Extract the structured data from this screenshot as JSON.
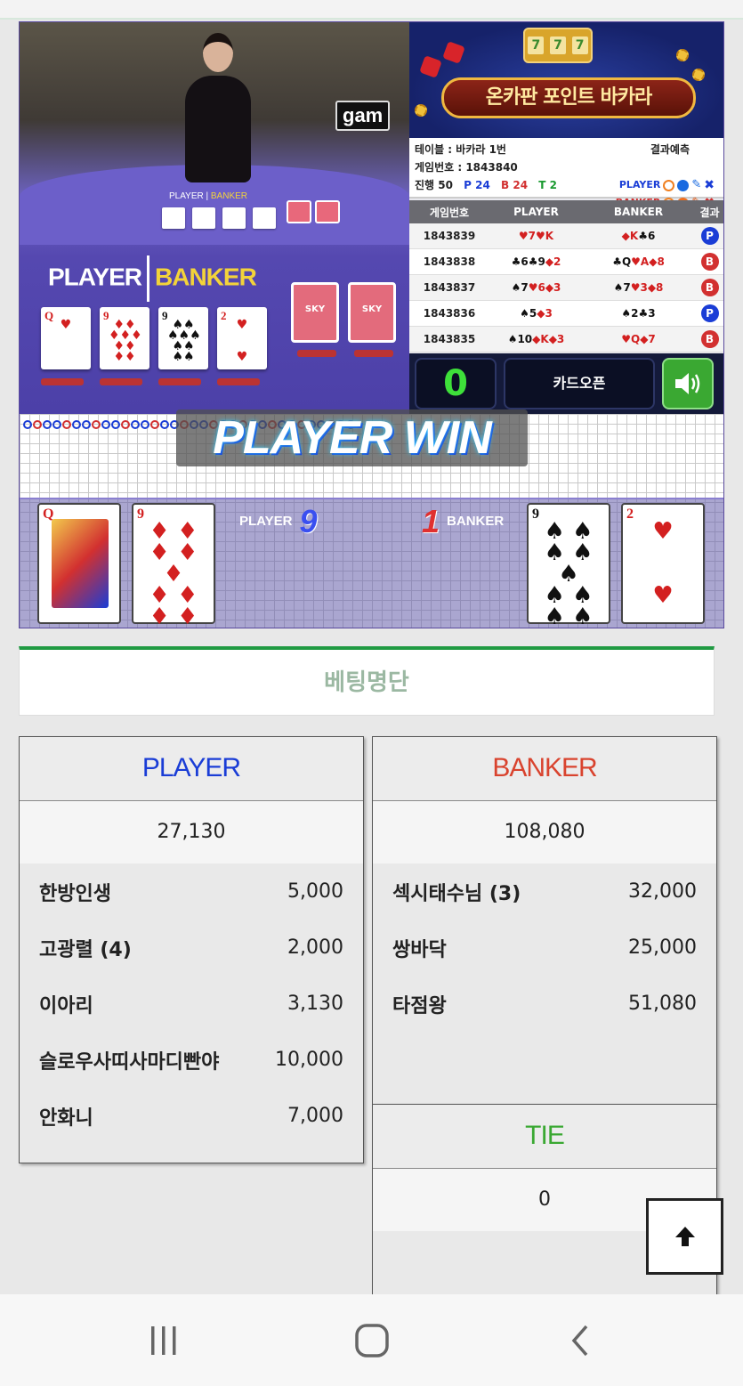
{
  "game": {
    "video": {
      "sign": "gam",
      "small_player": "PLAYER",
      "small_banker": "BANKER",
      "big_player": "PLAYER",
      "big_banker": "BANKER",
      "sky_label": "SKY"
    },
    "banner": {
      "slot": [
        "7",
        "7",
        "7"
      ],
      "title": "온카판 포인트 바카라"
    },
    "info": {
      "table": "테이블 : 바카라 1번",
      "prediction_label": "결과예측",
      "game_no": "게임번호 : 1843840",
      "progress_label": "진행 50",
      "p_count": "P 24",
      "b_count": "B 24",
      "t_count": "T 2",
      "pred_player": "PLAYER",
      "pred_banker": "BANKER"
    },
    "history": {
      "headers": [
        "게임번호",
        "PLAYER",
        "BANKER",
        "결과"
      ],
      "rows": [
        {
          "no": "1843839",
          "player": [
            {
              "s": "♥",
              "r": "7",
              "red": true
            },
            {
              "s": "♥",
              "r": "K",
              "red": true
            }
          ],
          "banker": [
            {
              "s": "◆",
              "r": "K",
              "red": true
            },
            {
              "s": "♣",
              "r": "6",
              "red": false
            }
          ],
          "result": "P"
        },
        {
          "no": "1843838",
          "player": [
            {
              "s": "♣",
              "r": "6",
              "red": false
            },
            {
              "s": "♣",
              "r": "9",
              "red": false
            },
            {
              "s": "◆",
              "r": "2",
              "red": true
            }
          ],
          "banker": [
            {
              "s": "♣",
              "r": "Q",
              "red": false
            },
            {
              "s": "♥",
              "r": "A",
              "red": true
            },
            {
              "s": "◆",
              "r": "8",
              "red": true
            }
          ],
          "result": "B"
        },
        {
          "no": "1843837",
          "player": [
            {
              "s": "♠",
              "r": "7",
              "red": false
            },
            {
              "s": "♥",
              "r": "6",
              "red": true
            },
            {
              "s": "◆",
              "r": "3",
              "red": true
            }
          ],
          "banker": [
            {
              "s": "♠",
              "r": "7",
              "red": false
            },
            {
              "s": "♥",
              "r": "3",
              "red": true
            },
            {
              "s": "◆",
              "r": "8",
              "red": true
            }
          ],
          "result": "B"
        },
        {
          "no": "1843836",
          "player": [
            {
              "s": "♠",
              "r": "5",
              "red": false
            },
            {
              "s": "◆",
              "r": "3",
              "red": true
            }
          ],
          "banker": [
            {
              "s": "♠",
              "r": "2",
              "red": false
            },
            {
              "s": "♣",
              "r": "3",
              "red": false
            }
          ],
          "result": "P"
        },
        {
          "no": "1843835",
          "player": [
            {
              "s": "♠",
              "r": "10",
              "red": false
            },
            {
              "s": "◆",
              "r": "K",
              "red": true
            },
            {
              "s": "◆",
              "r": "3",
              "red": true
            }
          ],
          "banker": [
            {
              "s": "♥",
              "r": "Q",
              "red": true
            },
            {
              "s": "◆",
              "r": "7",
              "red": true
            }
          ],
          "result": "B"
        }
      ]
    },
    "controls": {
      "timer": "0",
      "card_open": "카드오픈"
    },
    "result": {
      "win_text": "PLAYER WIN",
      "player_label": "PLAYER",
      "player_score": "9",
      "banker_label": "BANKER",
      "banker_score": "1"
    }
  },
  "betting": {
    "title": "베팅명단",
    "player": {
      "label": "PLAYER",
      "color": "#1a3dd6",
      "total": "27,130",
      "bets": [
        {
          "name": "한방인생",
          "amount": "5,000"
        },
        {
          "name": "고광렬 (4)",
          "amount": "2,000"
        },
        {
          "name": "이아리",
          "amount": "3,130"
        },
        {
          "name": "슬로우사띠사마디빤야",
          "amount": "10,000"
        },
        {
          "name": "안화니",
          "amount": "7,000"
        }
      ]
    },
    "banker": {
      "label": "BANKER",
      "color": "#d9432e",
      "total": "108,080",
      "bets": [
        {
          "name": "섹시태수님 (3)",
          "amount": "32,000"
        },
        {
          "name": "쌍바닥",
          "amount": "25,000"
        },
        {
          "name": "타점왕",
          "amount": "51,080"
        }
      ]
    },
    "tie": {
      "label": "TIE",
      "color": "#3aa832",
      "total": "0"
    }
  },
  "icons": {
    "scroll_top": "arrow-up-icon",
    "nav_recent": "recent-apps-icon",
    "nav_home": "home-icon",
    "nav_back": "back-icon",
    "sound": "speaker-icon"
  }
}
